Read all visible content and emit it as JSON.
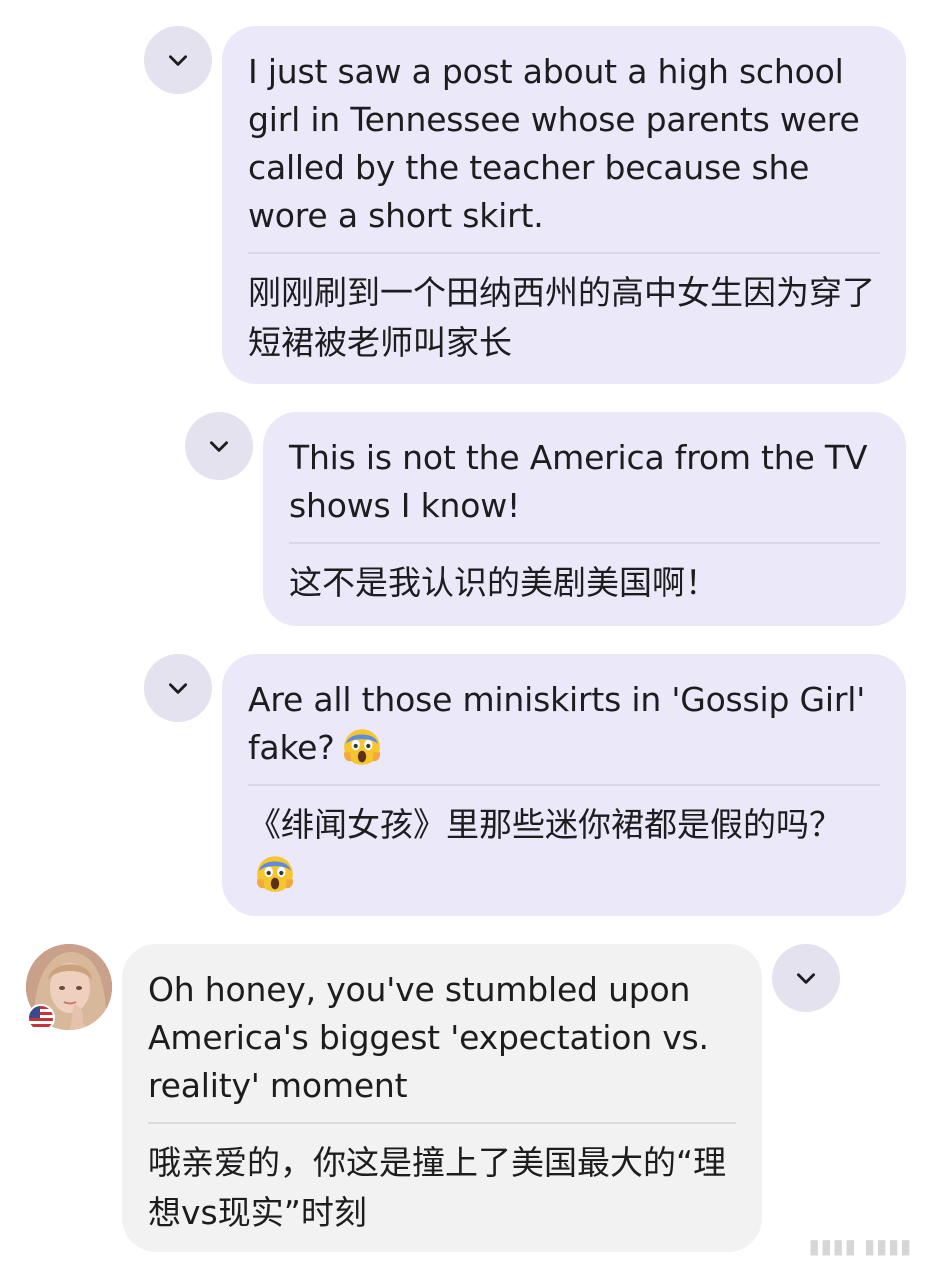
{
  "messages": [
    {
      "en": "I just saw a post about a high school girl in Tennessee whose parents were called by the teacher because she wore a short skirt.",
      "zh": "刚刚刷到一个田纳西州的高中女生因为穿了短裙被老师叫家长"
    },
    {
      "en": "This is not the America from the TV shows I know!",
      "zh": "这不是我认识的美剧美国啊！"
    },
    {
      "en": "Are all those miniskirts in 'Gossip Girl' fake?",
      "zh": "《绯闻女孩》里那些迷你裙都是假的吗？"
    },
    {
      "en": "Oh honey, you've stumbled upon America's biggest 'expectation vs. reality' moment",
      "zh": "哦亲爱的，你这是撞上了美国最大的“理想vs现实”时刻"
    }
  ],
  "icons": {
    "toggle": "chevron-down-icon",
    "emoji": "screaming-face-emoji",
    "flag": "us-flag-icon"
  },
  "colors": {
    "sent_bubble": "#ebe9f9",
    "received_bubble": "#f2f2f2",
    "toggle_bg": "#e4e2ee"
  }
}
